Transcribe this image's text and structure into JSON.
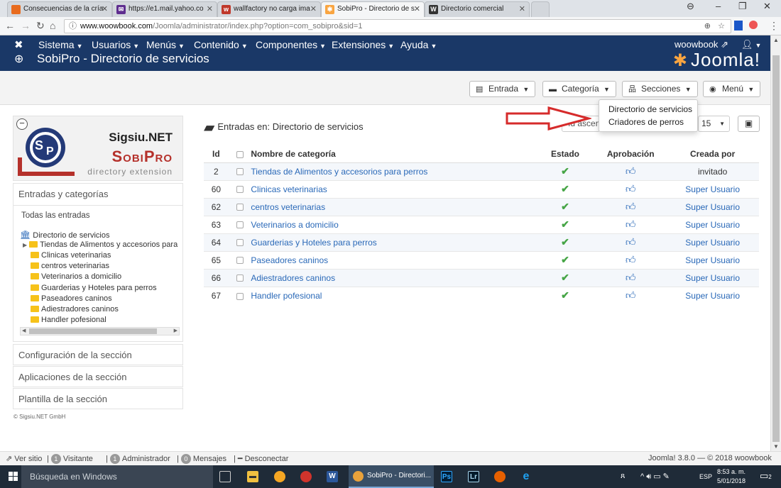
{
  "browser": {
    "tabs": [
      {
        "label": "Consecuencias de la cría",
        "icon": "orange-square-icon"
      },
      {
        "label": "https://e1.mail.yahoo.co",
        "icon": "yahoo-mail-icon"
      },
      {
        "label": "wallfactory no carga ima",
        "icon": "wf-icon"
      },
      {
        "label": "SobiPro - Directorio de s",
        "icon": "joomla-icon"
      },
      {
        "label": "Directorio comercial",
        "icon": "w-icon"
      }
    ],
    "url_host": "www.woowbook.com",
    "url_path": "/Joomla/administrator/index.php?option=com_sobipro&sid=1"
  },
  "adminbar": {
    "menu": [
      "Sistema",
      "Usuarios",
      "Menús",
      "Contenido",
      "Componentes",
      "Extensiones",
      "Ayuda"
    ],
    "site_link": "woowbook",
    "page_title": "SobiPro - Directorio de servicios",
    "brand": "Joomla!"
  },
  "toolbar": {
    "entrada": "Entrada",
    "categoria": "Categoría",
    "secciones": "Secciones",
    "menu": "Menú"
  },
  "dropdown": {
    "items": [
      "Directorio de servicios",
      "Criadores de perros"
    ]
  },
  "sidebar": {
    "logo_brand": "Sigsiu.NET",
    "logo_product": "SobiPro",
    "logo_tagline": "directory extension",
    "entries_header": "Entradas y categorías",
    "all_entries": "Todas las entradas",
    "tree_root": "Directorio de servicios",
    "tree_items": [
      "Tiendas de Alimentos y accesorios para",
      "Clinicas veterinarias",
      "centros veterinarias",
      "Veterinarios a domicilio",
      "Guarderias y Hoteles para perros",
      "Paseadores caninos",
      "Adiestradores caninos",
      "Handler pofesional"
    ],
    "config": "Configuración de la sección",
    "apps": "Aplicaciones de la sección",
    "template": "Plantilla de la sección",
    "copyright": "© Sigsiu.NET GmbH"
  },
  "main": {
    "title": "Entradas en: Directorio de servicios",
    "order_value": "Id ascendente",
    "limit_value": "15",
    "columns": {
      "id": "Id",
      "name": "Nombre de categoría",
      "state": "Estado",
      "approval": "Aprobación",
      "created_by": "Creada por"
    },
    "rows": [
      {
        "id": "2",
        "name": "Tiendas de Alimentos y accesorios para perros",
        "by": "invitado"
      },
      {
        "id": "60",
        "name": "Clinicas veterinarias",
        "by": "Super Usuario"
      },
      {
        "id": "62",
        "name": "centros veterinarias",
        "by": "Super Usuario"
      },
      {
        "id": "63",
        "name": "Veterinarios a domicilio",
        "by": "Super Usuario"
      },
      {
        "id": "64",
        "name": "Guarderias y Hoteles para perros",
        "by": "Super Usuario"
      },
      {
        "id": "65",
        "name": "Paseadores caninos",
        "by": "Super Usuario"
      },
      {
        "id": "66",
        "name": "Adiestradores caninos",
        "by": "Super Usuario"
      },
      {
        "id": "67",
        "name": "Handler pofesional",
        "by": "Super Usuario"
      }
    ]
  },
  "status": {
    "view_site": "Ver sitio",
    "visitors_count": "1",
    "visitors": "Visitante",
    "admins_count": "1",
    "admins": "Administrador",
    "messages_count": "0",
    "messages": "Mensajes",
    "logout": "Desconectar",
    "version": "Joomla! 3.8.0 — © 2018 woowbook"
  },
  "taskbar": {
    "search": "Búsqueda en Windows",
    "active_app": "SobiPro - Directori...",
    "lang": "ESP",
    "time": "8:53 a. m.",
    "date": "5/01/2018",
    "notif_count": "2"
  }
}
